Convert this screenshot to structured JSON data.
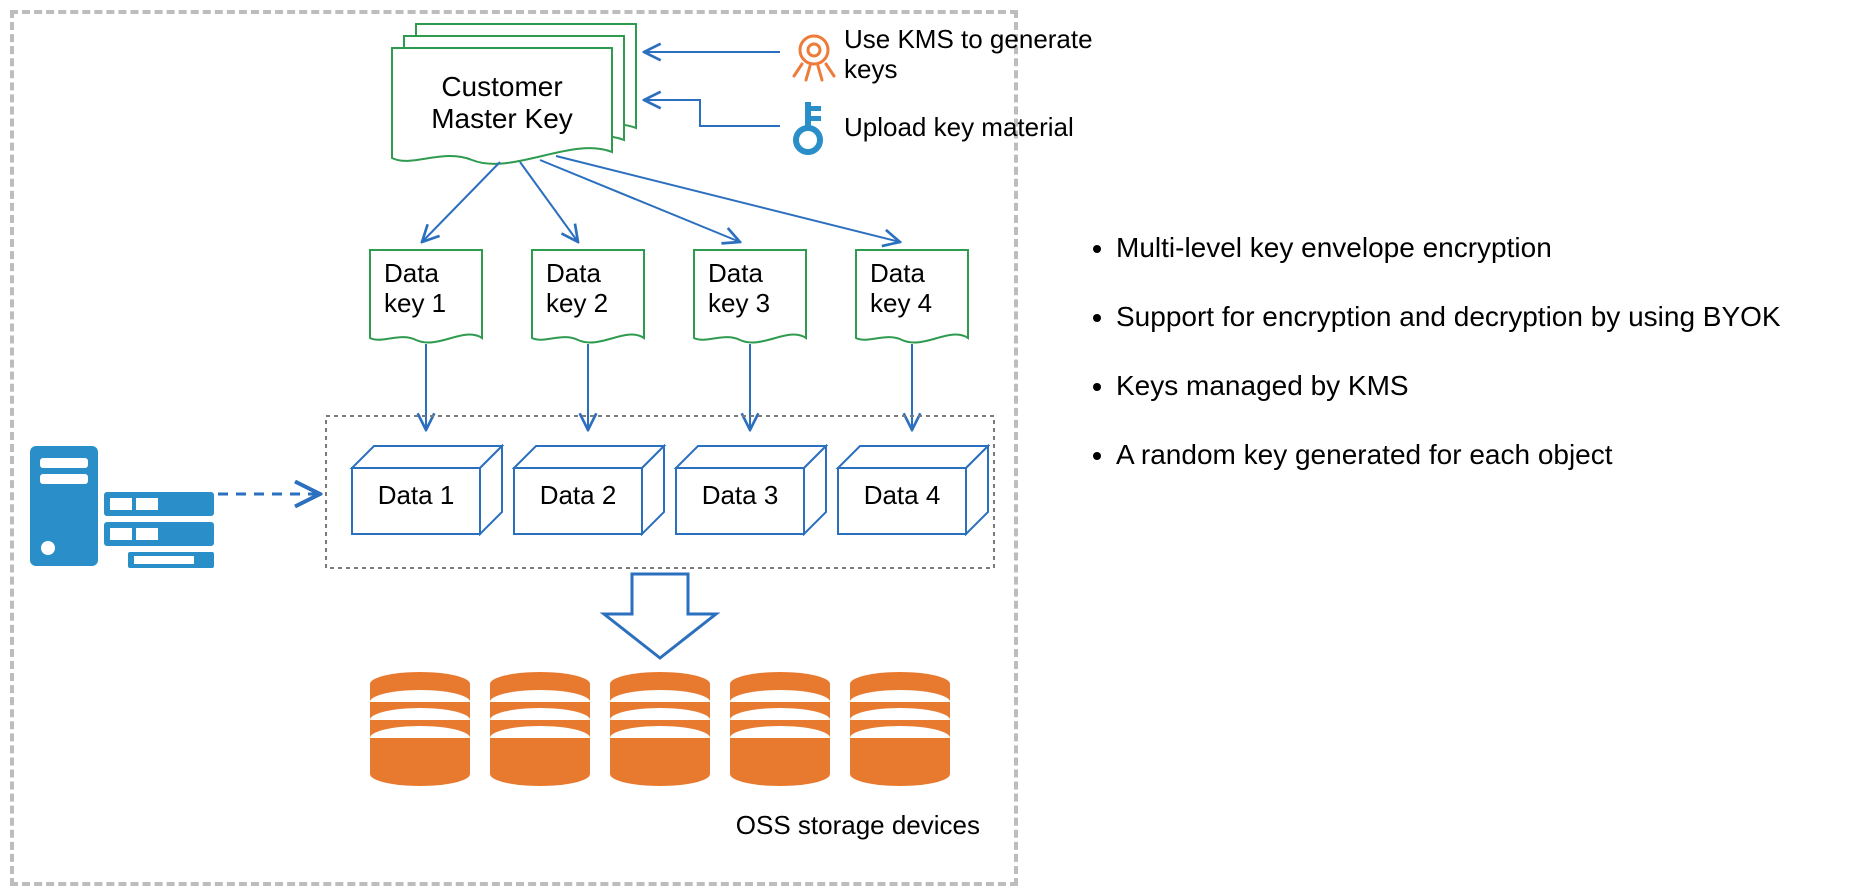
{
  "diagram": {
    "master_key_label_line1": "Customer",
    "master_key_label_line2": "Master Key",
    "kms_generate_label_line1": "Use KMS to generate",
    "kms_generate_label_line2": "keys",
    "upload_key_label": "Upload key material",
    "data_keys": [
      {
        "line1": "Data",
        "line2": "key 1"
      },
      {
        "line1": "Data",
        "line2": "key 2"
      },
      {
        "line1": "Data",
        "line2": "key 3"
      },
      {
        "line1": "Data",
        "line2": "key 4"
      }
    ],
    "data_boxes": [
      {
        "label": "Data 1"
      },
      {
        "label": "Data 2"
      },
      {
        "label": "Data 3"
      },
      {
        "label": "Data 4"
      }
    ],
    "storage_caption": "OSS storage devices"
  },
  "notes": {
    "items": [
      "Multi-level key envelope encryption",
      "Support for encryption and decryption by using BYOK",
      "Keys managed by KMS",
      "A random key generated for each object"
    ]
  },
  "colors": {
    "green": "#2e9b4f",
    "blue": "#2b6fbf",
    "dashed_grey": "#7a7a7a",
    "orange": "#e87a2f",
    "icon_blue": "#2a8fc8",
    "icon_orange": "#ed7b3a"
  }
}
